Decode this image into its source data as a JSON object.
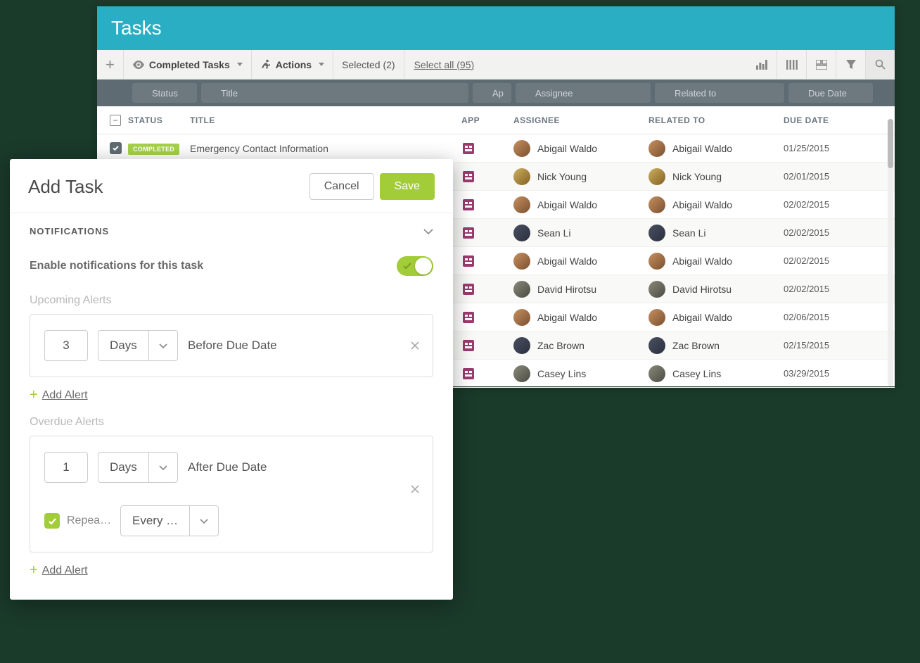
{
  "header": {
    "title": "Tasks"
  },
  "toolbar": {
    "completed_label": "Completed Tasks",
    "actions_label": "Actions",
    "selected_label": "Selected (2)",
    "select_all_label": "Select all (95)"
  },
  "filters": {
    "status": "Status",
    "title": "Title",
    "app": "Ap",
    "assignee": "Assignee",
    "related": "Related to",
    "due": "Due Date"
  },
  "columns": {
    "status": "STATUS",
    "title": "TITLE",
    "app": "APP",
    "assignee": "ASSIGNEE",
    "related": "RELATED TO",
    "due": "DUE DATE"
  },
  "status_badge": "COMPLETED",
  "rows": [
    {
      "checked": true,
      "show_badge": true,
      "title": "Emergency Contact Information",
      "assignee": "Abigail Waldo",
      "related": "Abigail Waldo",
      "due": "01/25/2015",
      "av": ""
    },
    {
      "title": "",
      "assignee": "Nick Young",
      "related": "Nick Young",
      "due": "02/01/2015",
      "av": "v3"
    },
    {
      "title": "",
      "assignee": "Abigail Waldo",
      "related": "Abigail Waldo",
      "due": "02/02/2015",
      "av": ""
    },
    {
      "title": "",
      "assignee": "Sean Li",
      "related": "Sean Li",
      "due": "02/02/2015",
      "av": "v2"
    },
    {
      "title": "",
      "assignee": "Abigail Waldo",
      "related": "Abigail Waldo",
      "due": "02/02/2015",
      "av": ""
    },
    {
      "title": "",
      "assignee": "David Hirotsu",
      "related": "David Hirotsu",
      "due": "02/02/2015",
      "av": "v4"
    },
    {
      "title": "",
      "assignee": "Abigail Waldo",
      "related": "Abigail Waldo",
      "due": "02/06/2015",
      "av": ""
    },
    {
      "title": "",
      "assignee": "Zac Brown",
      "related": "Zac Brown",
      "due": "02/15/2015",
      "av": "v2"
    },
    {
      "title": "",
      "assignee": "Casey Lins",
      "related": "Casey Lins",
      "due": "03/29/2015",
      "av": "v4"
    }
  ],
  "modal": {
    "title": "Add Task",
    "cancel": "Cancel",
    "save": "Save",
    "section": "NOTIFICATIONS",
    "enable_label": "Enable notifications for this task",
    "upcoming_label": "Upcoming Alerts",
    "overdue_label": "Overdue Alerts",
    "upcoming": {
      "value": "3",
      "unit": "Days",
      "suffix": "Before Due Date"
    },
    "overdue": {
      "value": "1",
      "unit": "Days",
      "suffix": "After Due Date",
      "repeat_label": "Repeat…",
      "every_label": "Every …"
    },
    "add_alert": "Add Alert"
  }
}
